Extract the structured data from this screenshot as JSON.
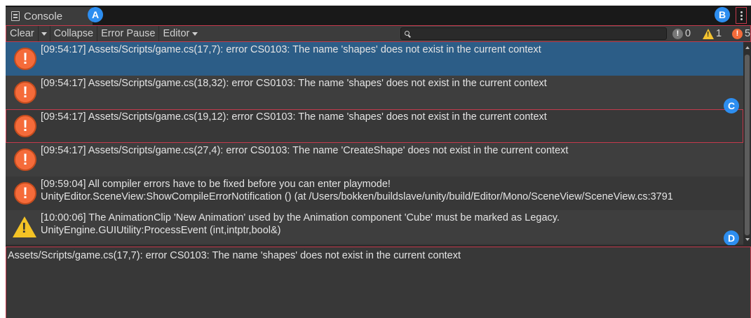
{
  "window": {
    "tab_label": "Console",
    "tab_icon": "console-doc-icon",
    "menu_icon": "kebab-menu-icon"
  },
  "callouts": {
    "a": "A",
    "b": "B",
    "c": "C",
    "d": "D"
  },
  "toolbar": {
    "clear_label": "Clear",
    "collapse_label": "Collapse",
    "error_pause_label": "Error Pause",
    "editor_label": "Editor",
    "search_value": "",
    "log_count": "0",
    "warning_count": "1",
    "error_count": "5"
  },
  "log_entries": [
    {
      "type": "error",
      "line1": "[09:54:17] Assets/Scripts/game.cs(17,7): error CS0103: The name 'shapes' does not exist in the current context",
      "line2": ""
    },
    {
      "type": "error",
      "line1": "[09:54:17] Assets/Scripts/game.cs(18,32): error CS0103: The name 'shapes' does not exist in the current context",
      "line2": ""
    },
    {
      "type": "error",
      "line1": "[09:54:17] Assets/Scripts/game.cs(19,12): error CS0103: The name 'shapes' does not exist in the current context",
      "line2": ""
    },
    {
      "type": "error",
      "line1": "[09:54:17] Assets/Scripts/game.cs(27,4): error CS0103: The name 'CreateShape' does not exist in the current context",
      "line2": ""
    },
    {
      "type": "error",
      "line1": "[09:59:04] All compiler errors have to be fixed before you can enter playmode!",
      "line2": "UnityEditor.SceneView:ShowCompileErrorNotification () (at /Users/bokken/buildslave/unity/build/Editor/Mono/SceneView/SceneView.cs:3791"
    },
    {
      "type": "warning",
      "line1": "[10:00:06] The AnimationClip 'New Animation' used by the Animation component 'Cube' must be marked as Legacy.",
      "line2": "UnityEngine.GUIUtility:ProcessEvent (int,intptr,bool&)"
    }
  ],
  "detail": {
    "text": "Assets/Scripts/game.cs(17,7): error CS0103: The name 'shapes' does not exist in the current context"
  },
  "colors": {
    "selection": "#2c5d87",
    "error": "#f56b3a",
    "warning": "#f4c325",
    "callout": "#2d8ef0",
    "highlight_outline": "#c43a4c"
  }
}
